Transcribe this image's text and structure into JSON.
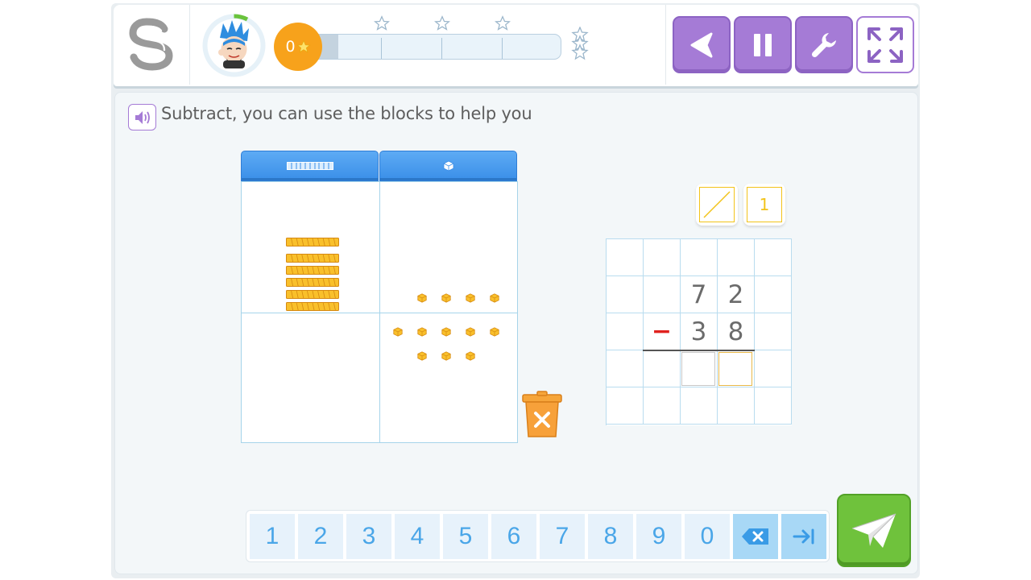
{
  "header": {
    "score": "0",
    "progress_fraction": 0.09,
    "progress_stars": 3,
    "controls": [
      "back-icon",
      "pause-icon",
      "wrench-icon",
      "fullscreen-icon"
    ]
  },
  "question": {
    "instruction": "Subtract, you can use the blocks to help you",
    "sound_icon": "speaker-icon"
  },
  "blocks": {
    "columns": [
      "tens",
      "ones"
    ],
    "top_tens": 6,
    "top_ones": 4,
    "bottom_ones": 8
  },
  "tools": {
    "slash_tool": "slash-icon",
    "one_label": "1"
  },
  "problem": {
    "top_tens": "7",
    "top_ones": "2",
    "operator": "−",
    "bottom_tens": "3",
    "bottom_ones": "8",
    "answer_tens": "",
    "answer_ones": ""
  },
  "keypad": {
    "keys": [
      "1",
      "2",
      "3",
      "4",
      "5",
      "6",
      "7",
      "8",
      "9",
      "0"
    ],
    "backspace_icon": "backspace-icon",
    "tab_icon": "tab-icon"
  },
  "colors": {
    "accent_purple": "#a57bd6",
    "send_green": "#6fc23c",
    "score_orange": "#f7a21b",
    "block_yellow": "#f9c02b"
  }
}
